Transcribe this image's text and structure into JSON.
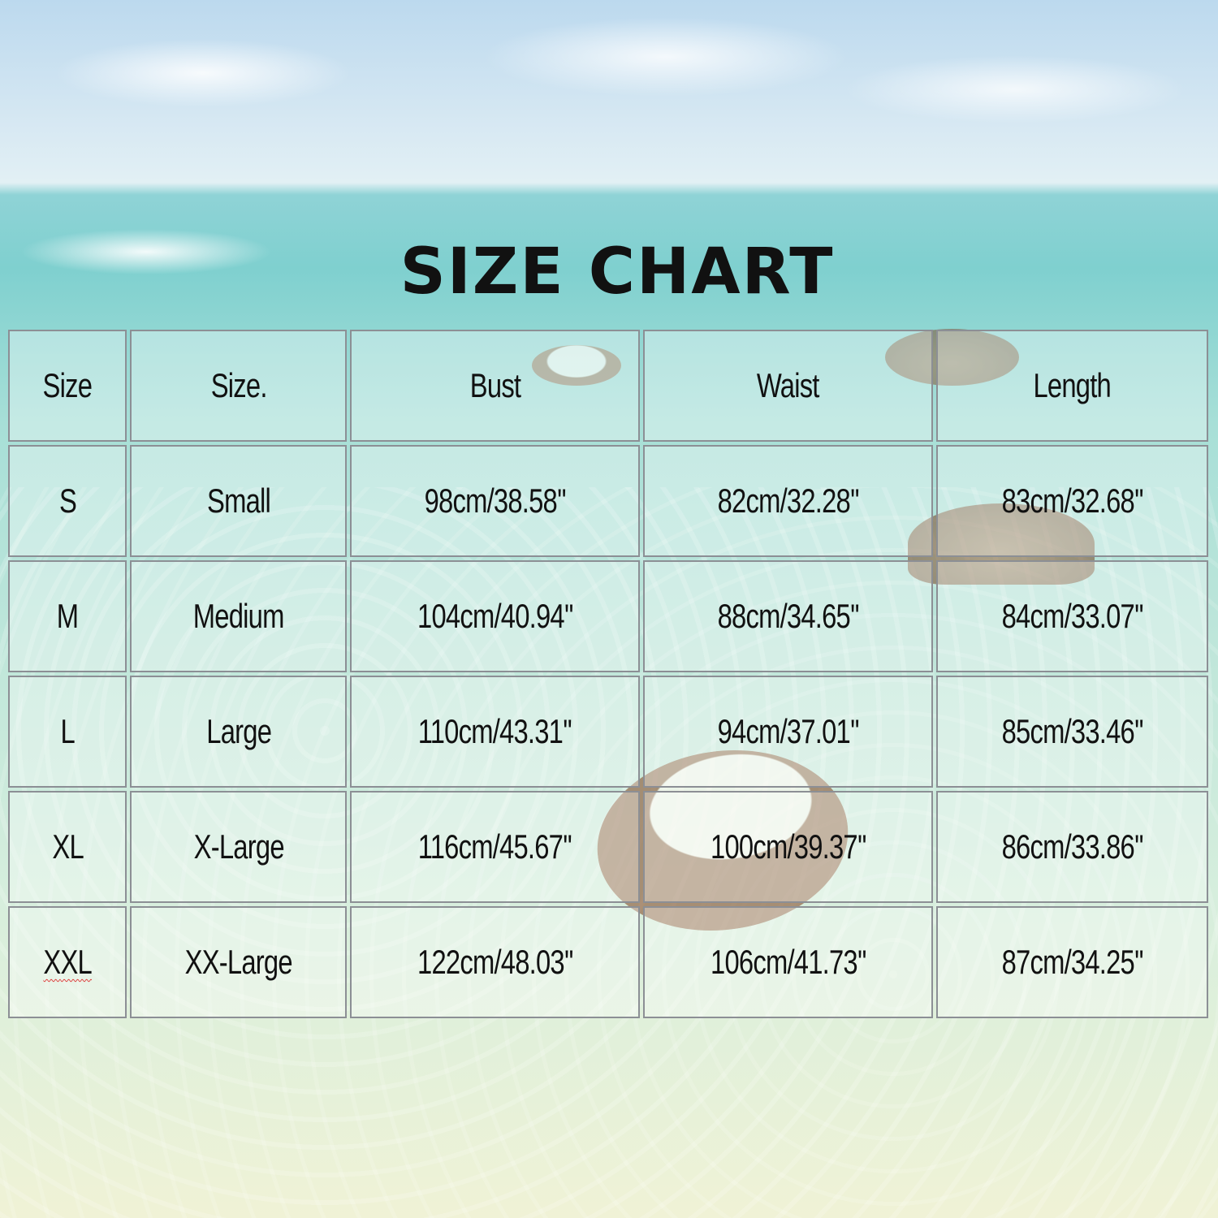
{
  "title": "SIZE CHART",
  "headers": [
    "Size",
    "Size.",
    "Bust",
    "Waist",
    "Length"
  ],
  "rows": [
    {
      "size": "S",
      "name": "Small",
      "bust": "98cm/38.58''",
      "waist": "82cm/32.28''",
      "length": "83cm/32.68''"
    },
    {
      "size": "M",
      "name": "Medium",
      "bust": "104cm/40.94''",
      "waist": "88cm/34.65''",
      "length": "84cm/33.07''"
    },
    {
      "size": "L",
      "name": "Large",
      "bust": "110cm/43.31''",
      "waist": "94cm/37.01''",
      "length": "85cm/33.46''"
    },
    {
      "size": "XL",
      "name": "X-Large",
      "bust": "116cm/45.67''",
      "waist": "100cm/39.37''",
      "length": "86cm/33.86''"
    },
    {
      "size": "XXL",
      "name": "XX-Large",
      "bust": "122cm/48.03''",
      "waist": "106cm/41.73''",
      "length": "87cm/34.25''"
    }
  ]
}
